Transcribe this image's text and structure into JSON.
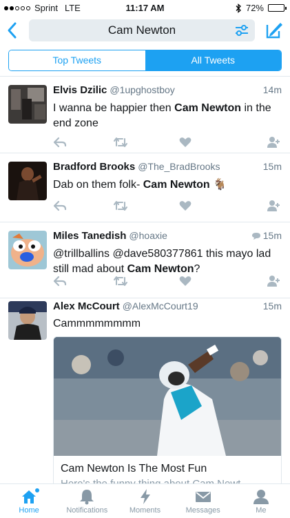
{
  "status_bar": {
    "carrier": "Sprint",
    "network": "LTE",
    "time": "11:17 AM",
    "battery": "72%",
    "battery_level": 0.72
  },
  "search": {
    "query": "Cam Newton"
  },
  "tabs": [
    {
      "label": "Top Tweets",
      "active": false
    },
    {
      "label": "All Tweets",
      "active": true
    }
  ],
  "tweets": [
    {
      "name": "Elvis Dzilic",
      "handle": "@1upghostboy",
      "time": "14m",
      "text_before": "I wanna be happier then ",
      "highlight": "Cam Newton",
      "text_after": " in the end zone"
    },
    {
      "name": "Bradford Brooks",
      "handle": "@The_BradBrooks",
      "time": "15m",
      "text_before": "Dab on them folk- ",
      "highlight": "Cam Newton",
      "text_after": " 🐐"
    },
    {
      "name": "Miles Tanedish",
      "handle": "@hoaxie",
      "time": "15m",
      "text_before": "@trillballins @dave580377861 this mayo lad still mad about ",
      "highlight": "Cam Newton",
      "text_after": "?"
    },
    {
      "name": "Alex McCourt",
      "handle": "@AlexMcCourt19",
      "time": "15m",
      "text": "Cammmmmmmm",
      "card_title": "Cam Newton Is The Most Fun",
      "card_desc": "Here's the funny thing about Cam Newt..."
    }
  ],
  "bottom_nav": [
    {
      "label": "Home",
      "icon": "home-icon",
      "active": true
    },
    {
      "label": "Notifications",
      "icon": "bell-icon",
      "active": false
    },
    {
      "label": "Moments",
      "icon": "lightning-icon",
      "active": false
    },
    {
      "label": "Messages",
      "icon": "envelope-icon",
      "active": false
    },
    {
      "label": "Me",
      "icon": "person-icon",
      "active": false
    }
  ],
  "colors": {
    "accent": "#1da1f2",
    "muted": "#657786",
    "icon": "#aab8c2"
  }
}
